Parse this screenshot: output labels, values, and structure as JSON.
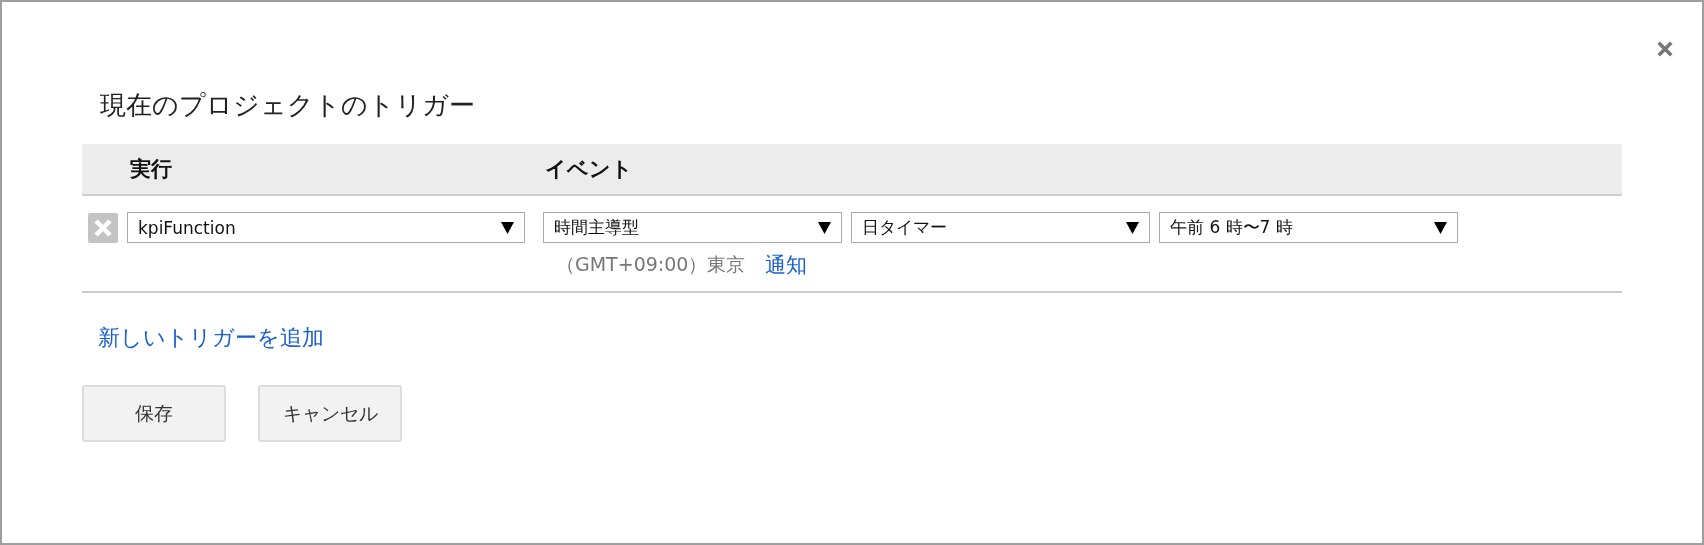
{
  "dialog": {
    "title": "現在のプロジェクトのトリガー"
  },
  "table": {
    "columns": [
      "実行",
      "イベント"
    ],
    "rows": [
      {
        "function": "kpiFunction",
        "event_selects": [
          "時間主導型",
          "日タイマー",
          "午前 6 時〜7 時"
        ],
        "timezone": "（GMT+09:00）東京",
        "notify_link": "通知"
      }
    ]
  },
  "add_link": "新しいトリガーを追加",
  "buttons": [
    "保存",
    "キャンセル"
  ]
}
